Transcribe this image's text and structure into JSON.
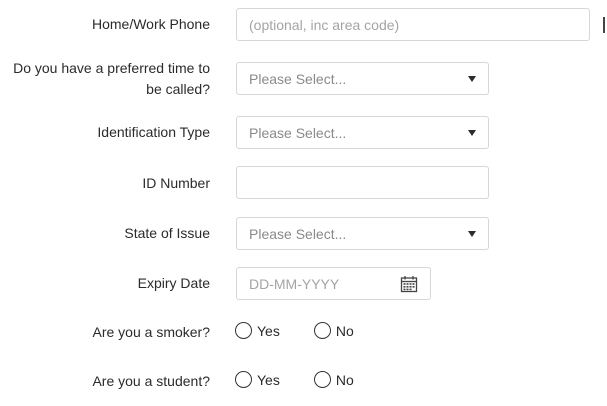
{
  "fields": {
    "phone": {
      "label": "Home/Work Phone",
      "placeholder": "(optional, inc area code)"
    },
    "preferred_time": {
      "label": "Do you have a preferred time to be called?",
      "value": "Please Select..."
    },
    "id_type": {
      "label": "Identification Type",
      "value": "Please Select..."
    },
    "id_number": {
      "label": "ID Number",
      "value": ""
    },
    "state": {
      "label": "State of Issue",
      "value": "Please Select..."
    },
    "expiry": {
      "label": "Expiry Date",
      "placeholder": "DD-MM-YYYY",
      "icon": "calendar-icon"
    }
  },
  "radios": {
    "smoker": {
      "label": "Are you a smoker?",
      "yes": "Yes",
      "no": "No"
    },
    "student": {
      "label": "Are you a student?",
      "yes": "Yes",
      "no": "No"
    }
  }
}
